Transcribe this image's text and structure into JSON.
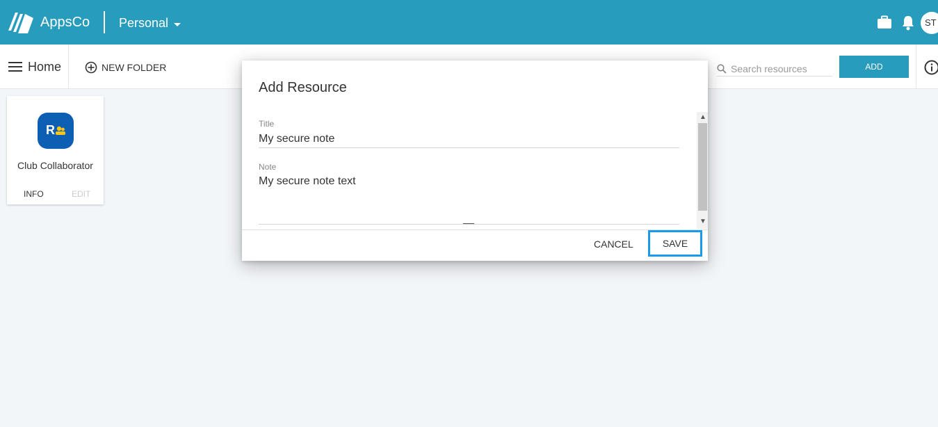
{
  "colors": {
    "brand": "#289cbd",
    "focus": "#1a9bea",
    "app_icon": "#0d5fb3"
  },
  "header": {
    "brand": "AppsCo",
    "workspace": "Personal",
    "avatar_initials": "ST",
    "icons": [
      "logo-icon",
      "briefcase-icon",
      "bell-icon"
    ]
  },
  "toolbar": {
    "home_label": "Home",
    "new_folder_label": "NEW FOLDER",
    "search_placeholder": "Search resources",
    "add_label": "ADD",
    "icons": [
      "menu-icon",
      "add-circle-icon",
      "search-icon",
      "info-icon"
    ]
  },
  "resources": [
    {
      "title": "Club Collaborator",
      "icon_text": "R",
      "info_label": "INFO",
      "edit_label": "EDIT"
    }
  ],
  "dialog": {
    "title": "Add Resource",
    "fields": [
      {
        "label": "Title",
        "value": "My secure note"
      },
      {
        "label": "Note",
        "value": "My secure note text"
      }
    ],
    "cancel_label": "CANCEL",
    "save_label": "SAVE"
  }
}
